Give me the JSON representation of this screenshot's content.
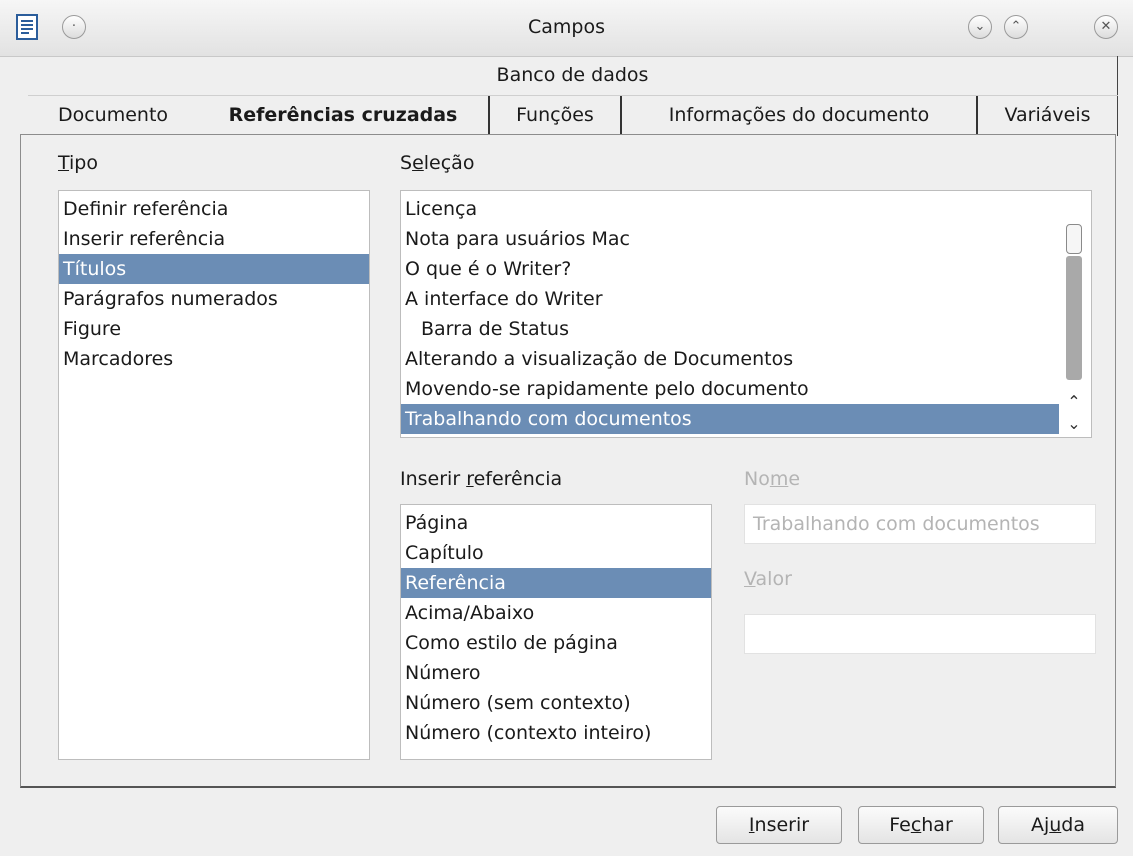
{
  "window": {
    "title": "Campos",
    "icons": [
      "document-icon",
      "circle-icon",
      "minimize-icon",
      "maximize-icon",
      "close-icon"
    ]
  },
  "tabs": {
    "row1": [
      "Banco de dados"
    ],
    "row2": [
      "Documento",
      "Referências cruzadas",
      "Funções",
      "Informações do documento",
      "Variáveis"
    ],
    "active": "Referências cruzadas"
  },
  "tipo": {
    "label_before": "",
    "label_mnemonic": "T",
    "label_after": "ipo",
    "items": [
      "Definir referência",
      "Inserir referência",
      "Títulos",
      "Parágrafos numerados",
      "Figure",
      "Marcadores"
    ],
    "selected": "Títulos"
  },
  "selecao": {
    "label_before": "S",
    "label_mnemonic": "e",
    "label_after": "leção",
    "items": [
      "Licença",
      "Nota para usuários Mac",
      "O que é o Writer?",
      "A interface do Writer",
      "Barra de Status",
      "Alterando a visualização de Documentos",
      "Movendo-se rapidamente pelo documento",
      "Trabalhando com documentos"
    ],
    "selected": "Trabalhando com documentos"
  },
  "inserir_ref": {
    "label_before": "Inserir ",
    "label_mnemonic": "r",
    "label_after": "eferência",
    "items": [
      "Página",
      "Capítulo",
      "Referência",
      "Acima/Abaixo",
      "Como estilo de página",
      "Número",
      "Número (sem contexto)",
      "Número (contexto inteiro)"
    ],
    "selected": "Referência"
  },
  "nome": {
    "label_before": "No",
    "label_mnemonic": "m",
    "label_after": "e",
    "value": "Trabalhando com documentos"
  },
  "valor": {
    "label_before": "",
    "label_mnemonic": "V",
    "label_after": "alor",
    "value": ""
  },
  "buttons": {
    "inserir": {
      "before": "",
      "mnemonic": "I",
      "after": "nserir"
    },
    "fechar": {
      "before": "Fe",
      "mnemonic": "c",
      "after": "har"
    },
    "ajuda": {
      "before": "Aj",
      "mnemonic": "u",
      "after": "da"
    }
  },
  "colors": {
    "selection": "#6b8db5",
    "disabled_text": "#b4b4b4",
    "dialog_bg": "#efefef"
  }
}
